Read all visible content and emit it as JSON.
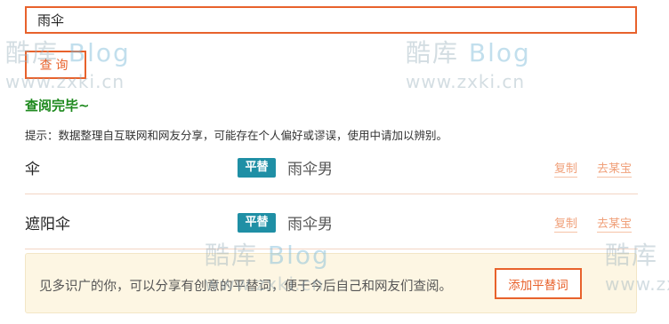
{
  "search": {
    "value": "雨伞",
    "button_label": "查询"
  },
  "status": {
    "done_message": "查阅完毕~",
    "tip": "提示：数据整理自互联网和网友分享，可能存在个人偏好或谬误，使用中请加以辨别。"
  },
  "results": [
    {
      "term": "伞",
      "badge": "平替",
      "alternative": "雨伞男",
      "copy_label": "复制",
      "shop_label": "去某宝"
    },
    {
      "term": "遮阳伞",
      "badge": "平替",
      "alternative": "雨伞男",
      "copy_label": "复制",
      "shop_label": "去某宝"
    }
  ],
  "share": {
    "text": "见多识广的你，可以分享有创意的平替词，便于今后自己和网友们查阅。",
    "button_label": "添加平替词"
  },
  "watermark": {
    "logo_cn": "酷库",
    "logo_en": "Blog",
    "url": "www.zxki.cn"
  }
}
